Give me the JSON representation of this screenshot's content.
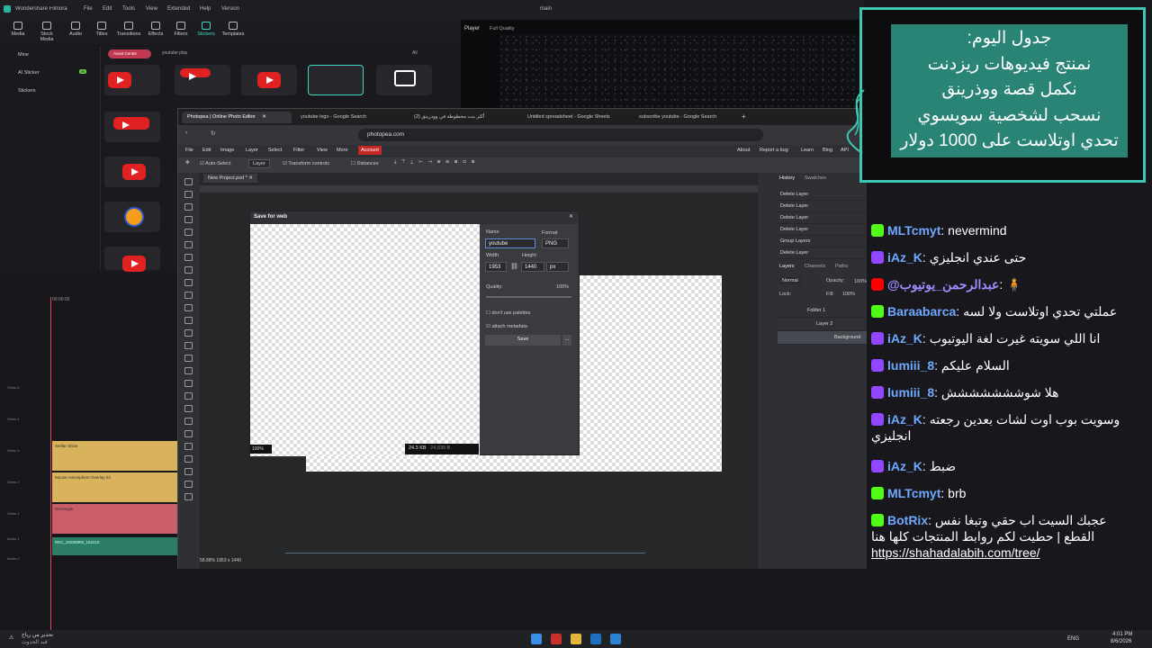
{
  "filmora": {
    "app_name": "Wondershare Filmora",
    "menu": [
      "File",
      "Edit",
      "Tools",
      "View",
      "Extended",
      "Help",
      "Version"
    ],
    "project_name": "main",
    "toolbar": [
      "Media",
      "Stock Media",
      "Audio",
      "Titles",
      "Transitions",
      "Effects",
      "Filters",
      "Stickers",
      "Templates"
    ],
    "sidebar": [
      "Mine",
      "AI Sticker",
      "Stickers"
    ],
    "ai_badge": "AI",
    "search_value": "youtube play",
    "asset_tab": "Asset Center",
    "filter": "All",
    "player_label": "Player",
    "quality": "Full Quality",
    "timeline_clips": [
      "Stellar Shine",
      "Mouse Atmosphere Overlay 03",
      "Rectangle",
      "REC_20260806_152418"
    ],
    "track_labels": [
      "Video 5",
      "Video 4",
      "Video 3",
      "Video 2",
      "Video 1",
      "Audio 1",
      "Audio 2"
    ],
    "time": "00:00:00"
  },
  "browser": {
    "tabs": [
      "Photopea | Online Photo Editor",
      "youtube logo - Google Search",
      "أكثر بنت محظوظة في ووذرينق (2)",
      "Untitled spreadsheet - Google Sheets",
      "subscribe youtube - Google Search"
    ],
    "url": "photopea.com"
  },
  "photopea": {
    "menu": [
      "File",
      "Edit",
      "Image",
      "Layer",
      "Select",
      "Filter",
      "View",
      "More",
      "Account"
    ],
    "menu_right": [
      "About",
      "Report a bug",
      "Learn",
      "Blog",
      "API"
    ],
    "auto_select": "Auto-Select",
    "layer_select": "Layer",
    "transform_controls": "Transform controls",
    "distances": "Distances",
    "doc_tab": "New Project.psd *",
    "status": "58.88%    1953 x 1440",
    "history_tab": "History",
    "swatches_tab": "Swatches",
    "history": [
      "Delete Layer",
      "Delete Layer",
      "Delete Layer",
      "Delete Layer",
      "Group Layers",
      "Delete Layer"
    ],
    "layers_tabs": [
      "Layers",
      "Channels",
      "Paths"
    ],
    "blend_mode": "Normal",
    "opacity_label": "Opacity:",
    "opacity": "100%",
    "lock_label": "Lock:",
    "fill_label": "Fill:",
    "fill": "100%",
    "layers": [
      "Folder 1",
      "Layer 2",
      "Background"
    ]
  },
  "save_dialog": {
    "title": "Save for web",
    "name_label": "Name",
    "name_value": "youtube",
    "format_label": "Format",
    "format_value": "PNG",
    "width_label": "Width",
    "height_label": "Height",
    "width": "1953",
    "height": "1440",
    "unit": "px",
    "quality_label": "Quality:",
    "quality": "100%",
    "palettes": "don't use palettes",
    "metadata": "attach metadata",
    "save": "Save",
    "more": "...",
    "zoom": "100%",
    "size_a": "24.3 KB",
    "size_b": "24,839 B"
  },
  "schedule": {
    "lines": [
      "جدول اليوم:",
      "نمنتج فيديوهات ريزدنت",
      "نكمل قصة ووذرينق",
      "نسحب لشخصية سويسوي",
      "تحدي اوتلاست على 1000 دولار"
    ]
  },
  "chat": [
    {
      "badge": "kick",
      "user": "MLTcmyt",
      "text": "nevermind"
    },
    {
      "badge": "twitch",
      "user": "iAz_K",
      "text": "حتى عندي انجليزي"
    },
    {
      "badge": "youtube",
      "user": "@عبدالرحمن_يوتيوب",
      "text": "🧍"
    },
    {
      "badge": "kick",
      "user": "Baraabarca",
      "text": "عملتي تحدي اوتلاست ولا لسه"
    },
    {
      "badge": "twitch",
      "user": "iAz_K",
      "text": "انا اللي سويته غيرت لغة اليوتيوب"
    },
    {
      "badge": "twitch",
      "user": "lumiii_8",
      "text": "السلام عليكم"
    },
    {
      "badge": "twitch",
      "user": "lumiii_8",
      "text": "هلا شوششششششش"
    },
    {
      "badge": "twitch",
      "user": "iAz_K",
      "text": "وسويت بوب اوت لشات بعدين رجعته انجليزي"
    },
    {
      "badge": "twitch",
      "user": "iAz_K",
      "text": "ضبط"
    },
    {
      "badge": "kick",
      "user": "MLTcmyt",
      "text": "brb"
    },
    {
      "badge": "kick",
      "user": "BotRix",
      "text": "عجبك السيت اب حقي وتبغا نفس القطع | حطيت لكم روابط المنتجات كلها هنا",
      "link": "https://shahadalabih.com/tree/"
    }
  ],
  "taskbar": {
    "weather_line1": "تحذير من رياح",
    "weather_line2": "قيد الحدوث",
    "lang": "ENG",
    "time": "4:01 PM",
    "date": "8/6/2026"
  },
  "colors": {
    "overlay_teal": "#2a8476",
    "overlay_border": "#3fc7b2",
    "kick_green": "#53fc18",
    "twitch_purple": "#9146ff",
    "youtube_red": "#ff0000",
    "username_blue": "#6fa8ff"
  }
}
